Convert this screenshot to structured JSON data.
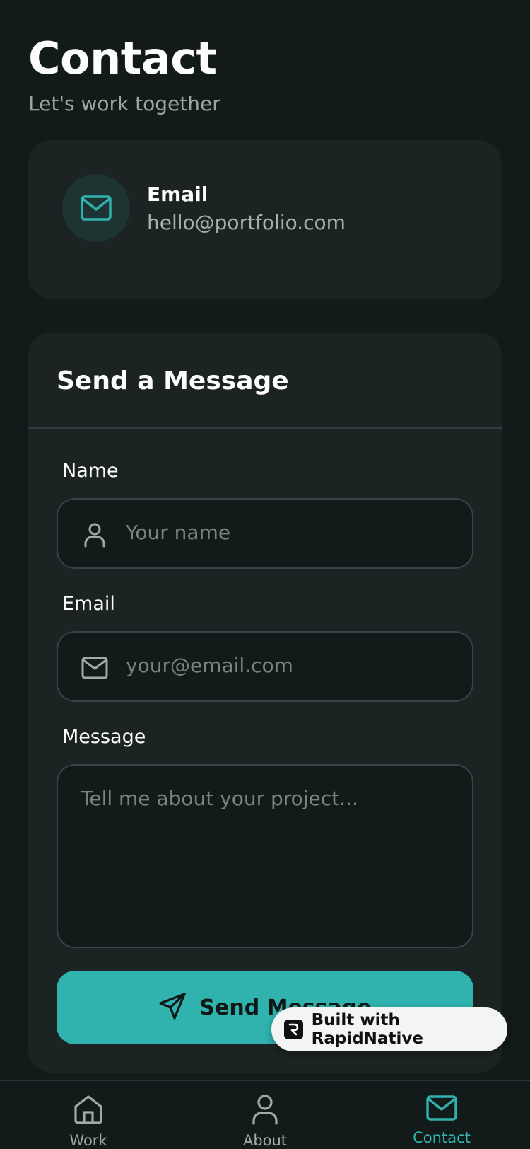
{
  "header": {
    "title": "Contact",
    "subtitle": "Let's work together"
  },
  "contact_card": {
    "icon": "mail-icon",
    "label": "Email",
    "value": "hello@portfolio.com"
  },
  "form": {
    "heading": "Send a Message",
    "name_label": "Name",
    "name_placeholder": "Your name",
    "name_value": "",
    "email_label": "Email",
    "email_placeholder": "your@email.com",
    "email_value": "",
    "message_label": "Message",
    "message_placeholder": "Tell me about your project...",
    "message_value": "",
    "submit_label": "Send Message"
  },
  "badge": {
    "text": "Built with RapidNative"
  },
  "tabbar": {
    "items": [
      {
        "label": "Work",
        "icon": "home-icon",
        "active": false
      },
      {
        "label": "About",
        "icon": "user-icon",
        "active": false
      },
      {
        "label": "Contact",
        "icon": "mail-icon",
        "active": true
      }
    ]
  },
  "colors": {
    "background": "#131a1a",
    "card": "#1c2323",
    "accent": "#30b2ae",
    "muted_text": "#9aa6a4"
  }
}
